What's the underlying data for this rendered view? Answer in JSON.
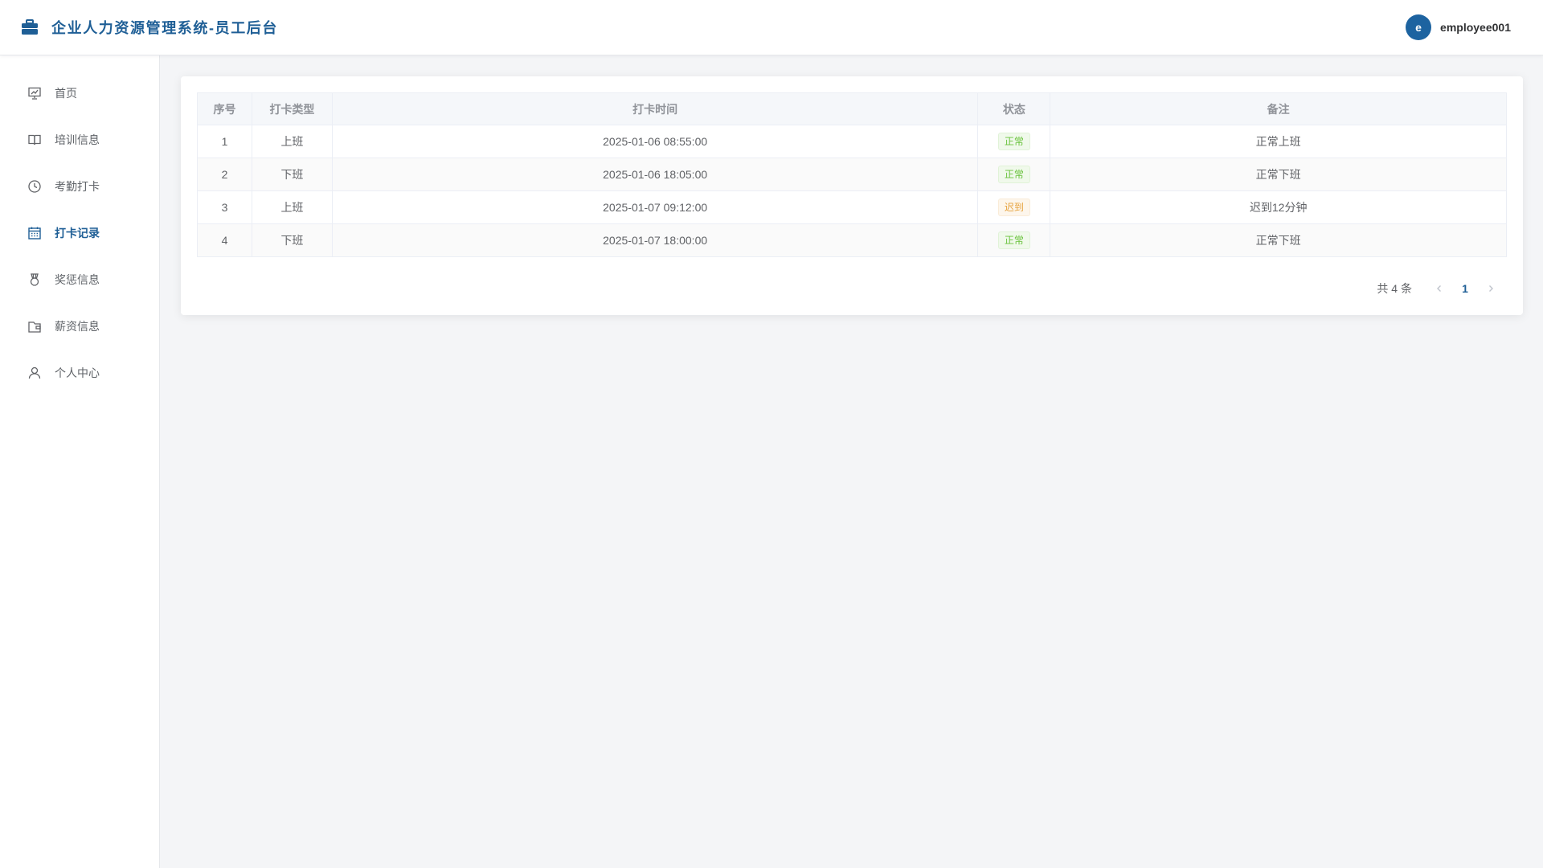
{
  "app": {
    "title": "企业人力资源管理系统-员工后台",
    "brand_color": "#1f5f96"
  },
  "user": {
    "avatar_letter": "e",
    "name": "employee001"
  },
  "sidebar": {
    "items": [
      {
        "label": "首页",
        "icon": "presentation-board-icon",
        "active": false
      },
      {
        "label": "培训信息",
        "icon": "open-book-icon",
        "active": false
      },
      {
        "label": "考勤打卡",
        "icon": "clock-icon",
        "active": false
      },
      {
        "label": "打卡记录",
        "icon": "calendar-icon",
        "active": true
      },
      {
        "label": "奖惩信息",
        "icon": "medal-icon",
        "active": false
      },
      {
        "label": "薪资信息",
        "icon": "wallet-icon",
        "active": false
      },
      {
        "label": "个人中心",
        "icon": "user-icon",
        "active": false
      }
    ]
  },
  "table": {
    "columns": [
      "序号",
      "打卡类型",
      "打卡时间",
      "状态",
      "备注"
    ],
    "rows": [
      {
        "index": "1",
        "type": "上班",
        "time": "2025-01-06 08:55:00",
        "status": "正常",
        "status_kind": "success",
        "remark": "正常上班"
      },
      {
        "index": "2",
        "type": "下班",
        "time": "2025-01-06 18:05:00",
        "status": "正常",
        "status_kind": "success",
        "remark": "正常下班"
      },
      {
        "index": "3",
        "type": "上班",
        "time": "2025-01-07 09:12:00",
        "status": "迟到",
        "status_kind": "warning",
        "remark": "迟到12分钟"
      },
      {
        "index": "4",
        "type": "下班",
        "time": "2025-01-07 18:00:00",
        "status": "正常",
        "status_kind": "success",
        "remark": "正常下班"
      }
    ]
  },
  "pagination": {
    "total_label": "共 4 条",
    "current_page": "1",
    "prev_icon": "chevron-left-icon",
    "next_icon": "chevron-right-icon"
  }
}
